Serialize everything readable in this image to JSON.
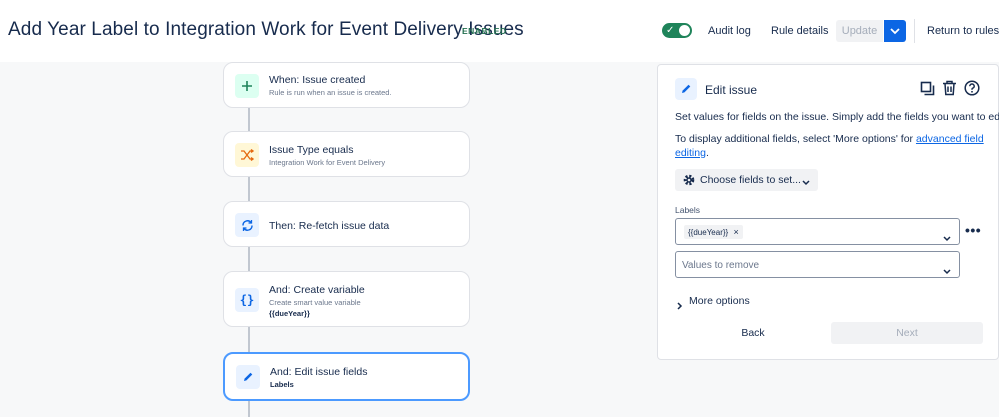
{
  "header": {
    "title": "Add Year Label to Integration Work for Event Delivery Issues",
    "status_badge": "ENABLED",
    "audit_log": "Audit log",
    "rule_details": "Rule details",
    "update": "Update",
    "return_to_rules": "Return to rules",
    "toggle_enabled": true
  },
  "flow": {
    "nodes": [
      {
        "title": "When: Issue created",
        "subtitle": "Rule is run when an issue is created.",
        "icon": "plus-icon"
      },
      {
        "title": "Issue Type equals",
        "subtitle": "Integration Work for Event Delivery",
        "icon": "shuffle-icon"
      },
      {
        "title": "Then: Re-fetch issue data",
        "icon": "refresh-icon"
      },
      {
        "title": "And: Create variable",
        "subtitle": "Create smart value variable",
        "detail": "{{dueYear}}",
        "icon": "braces-icon"
      },
      {
        "title": "And: Edit issue fields",
        "detail": "Labels",
        "icon": "pencil-icon",
        "selected": true
      }
    ]
  },
  "panel": {
    "title": "Edit issue",
    "description": "Set values for fields on the issue. Simply add the fields you want to edit.",
    "additional_prefix": "To display additional fields, select 'More options' for ",
    "additional_link_1": "advanced field",
    "additional_link_2": "editing",
    "additional_suffix": ".",
    "choose_fields": "Choose fields to set...",
    "labels_label": "Labels",
    "labels_tag": "{{dueYear}}",
    "remove_placeholder": "Values to remove",
    "more_options": "More options",
    "back": "Back",
    "next": "Next"
  },
  "colors": {
    "accent": "#0c66e4",
    "enabled_green": "#1f845a",
    "selected_border": "#4c9aff"
  }
}
